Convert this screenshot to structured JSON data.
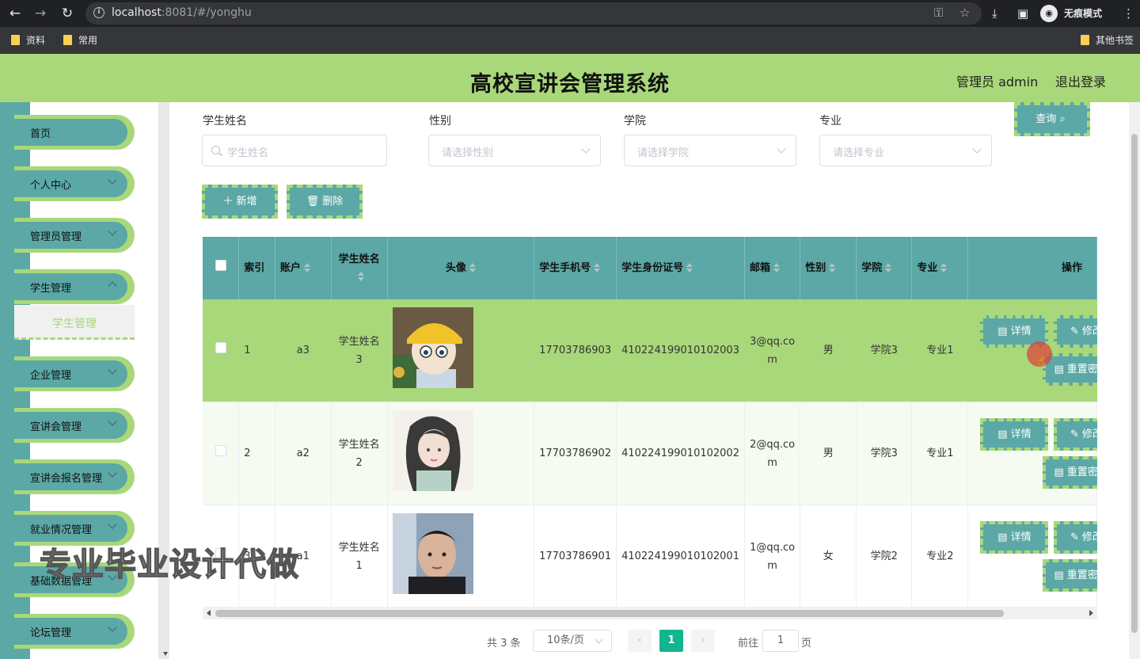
{
  "browser": {
    "url_host": "localhost",
    "url_rest": ":8081/#/yonghu",
    "incognito_label": "无痕模式",
    "bookmarks": [
      "资料",
      "常用"
    ],
    "other_bookmarks": "其他书签"
  },
  "header": {
    "title": "高校宣讲会管理系统",
    "user": "管理员 admin",
    "logout": "退出登录"
  },
  "sidebar": {
    "items": [
      {
        "label": "首页"
      },
      {
        "label": "个人中心"
      },
      {
        "label": "管理员管理"
      },
      {
        "label": "学生管理"
      },
      {
        "label": "企业管理"
      },
      {
        "label": "宣讲会管理"
      },
      {
        "label": "宣讲会报名管理"
      },
      {
        "label": "就业情况管理"
      },
      {
        "label": "基础数据管理"
      },
      {
        "label": "论坛管理"
      }
    ],
    "active_sub": "学生管理"
  },
  "filters": {
    "name_label": "学生姓名",
    "name_placeholder": "学生姓名",
    "gender_label": "性别",
    "gender_placeholder": "请选择性别",
    "college_label": "学院",
    "college_placeholder": "请选择学院",
    "major_label": "专业",
    "major_placeholder": "请选择专业",
    "query_button": "查询"
  },
  "actions": {
    "add": "新增",
    "delete": "删除"
  },
  "table": {
    "headers": {
      "index": "索引",
      "account": "账户",
      "name": "学生姓名",
      "avatar": "头像",
      "phone": "学生手机号",
      "idcard": "学生身份证号",
      "email": "邮箱",
      "gender": "性别",
      "college": "学院",
      "major": "专业",
      "ops": "操作"
    },
    "rows": [
      {
        "index": "1",
        "account": "a3",
        "name": "学生姓名3",
        "phone": "17703786903",
        "idcard": "410224199010102003",
        "email": "3@qq.com",
        "gender": "男",
        "college": "学院3",
        "major": "专业1"
      },
      {
        "index": "2",
        "account": "a2",
        "name": "学生姓名2",
        "phone": "17703786902",
        "idcard": "410224199010102002",
        "email": "2@qq.com",
        "gender": "男",
        "college": "学院3",
        "major": "专业1"
      },
      {
        "index": "3",
        "account": "a1",
        "name": "学生姓名1",
        "phone": "17703786901",
        "idcard": "410224199010102001",
        "email": "1@qq.com",
        "gender": "女",
        "college": "学院2",
        "major": "专业2"
      }
    ],
    "op_detail": "详情",
    "op_edit": "修改",
    "op_reset": "重置密码"
  },
  "pagination": {
    "total": "共 3 条",
    "page_size": "10条/页",
    "current": "1",
    "goto_label": "前往",
    "goto_value": "1",
    "page_suffix": "页"
  },
  "watermark": "专业毕业设计代做"
}
